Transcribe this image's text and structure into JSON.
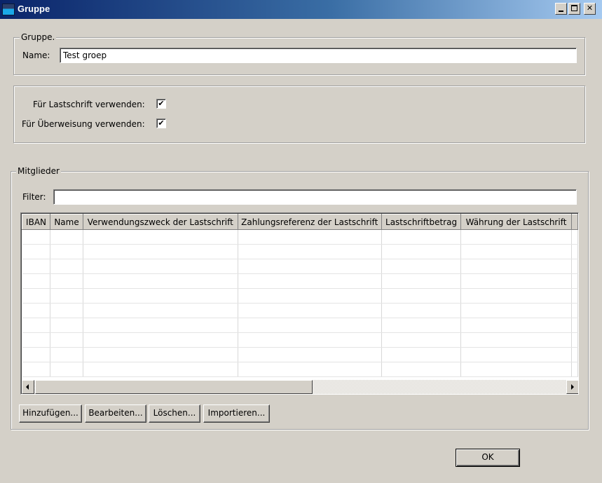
{
  "window": {
    "title": "Gruppe",
    "icon": "app-icon"
  },
  "group_section": {
    "legend": "Gruppe.",
    "name_label": "Name:",
    "name_value": "Test groep"
  },
  "options": {
    "direct_debit_label": "Für Lastschrift verwenden:",
    "direct_debit_checked": true,
    "transfer_label": "Für Überweisung verwenden:",
    "transfer_checked": true
  },
  "members": {
    "legend": "Mitglieder",
    "filter_label": "Filter:",
    "filter_value": "",
    "columns": [
      "IBAN",
      "Name",
      "Verwendungszweck der Lastschrift",
      "Zahlungsreferenz der Lastschrift",
      "Lastschriftbetrag",
      "Währung der Lastschrift"
    ],
    "rows": []
  },
  "buttons": {
    "add": "Hinzufügen...",
    "edit": "Bearbeiten...",
    "delete": "Löschen...",
    "import": "Importieren...",
    "ok": "OK"
  }
}
